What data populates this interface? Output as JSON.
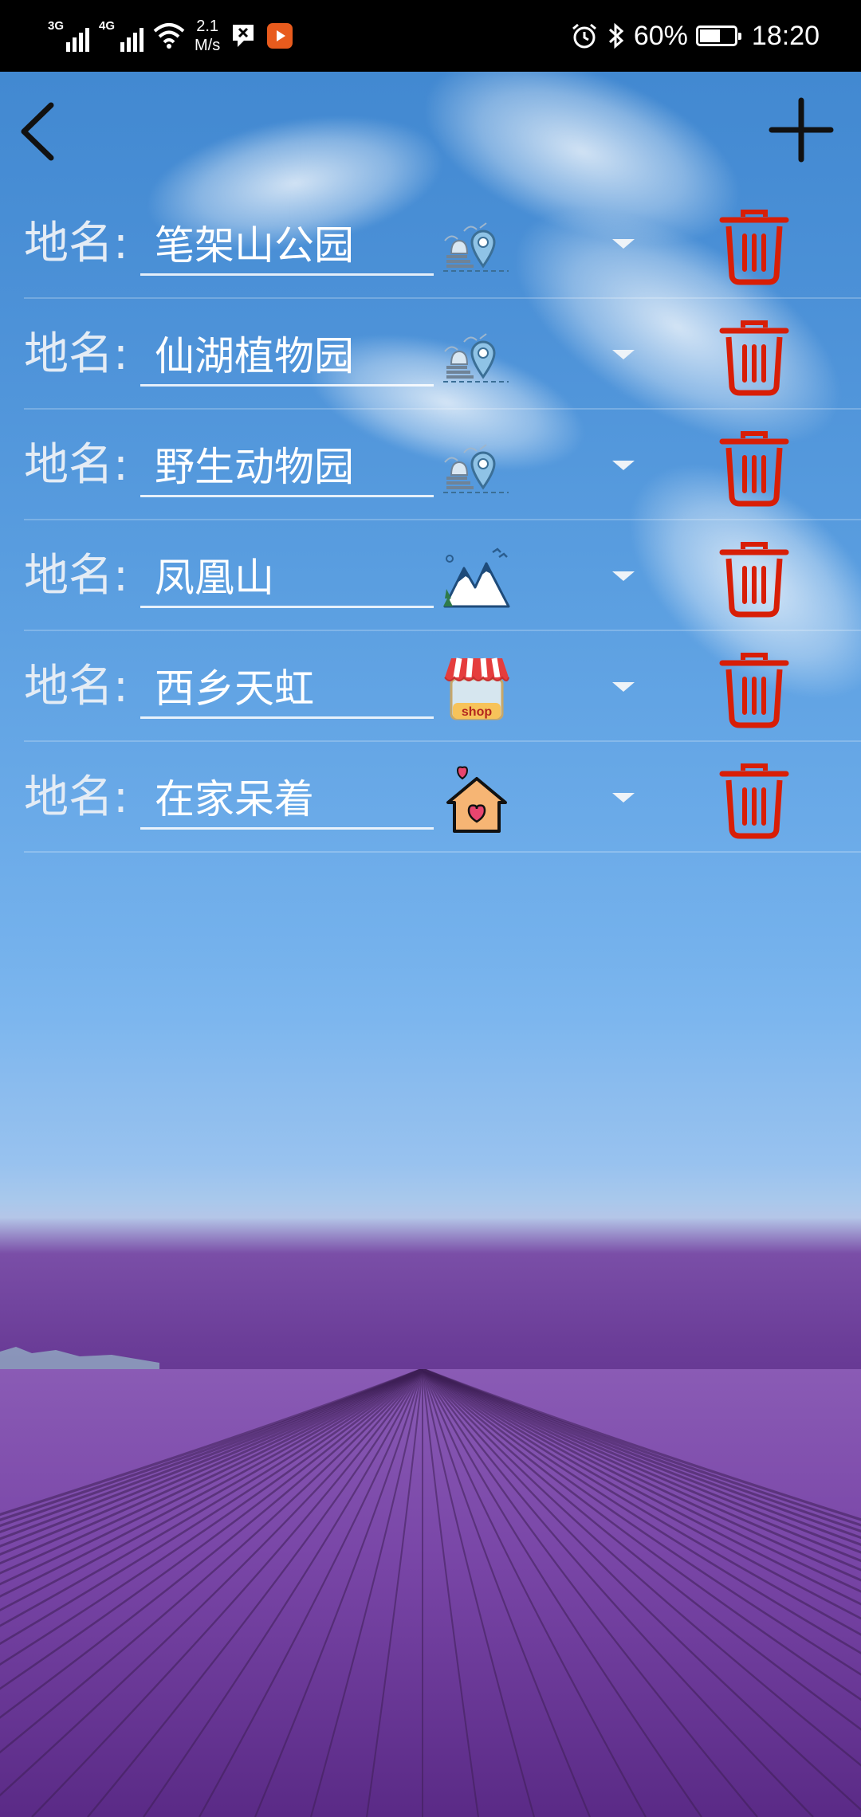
{
  "status_bar": {
    "signal1_tag": "3G",
    "signal2_tag": "4G",
    "speed_value": "2.1",
    "speed_unit": "M/s",
    "battery_percent": "60%",
    "battery_level": 0.6,
    "time": "18:20"
  },
  "toolbar": {
    "back_icon": "chevron-left-icon",
    "add_icon": "plus-icon"
  },
  "place_label": "地名:",
  "places": [
    {
      "name": "笔架山公园",
      "icon": "park-location-icon"
    },
    {
      "name": "仙湖植物园",
      "icon": "park-location-icon"
    },
    {
      "name": "野生动物园",
      "icon": "park-location-icon"
    },
    {
      "name": "凤凰山",
      "icon": "mountain-icon"
    },
    {
      "name": "西乡天虹",
      "icon": "shop-icon"
    },
    {
      "name": "在家呆着",
      "icon": "home-heart-icon"
    }
  ],
  "shop_sign": "shop",
  "colors": {
    "delete": "#d81e06",
    "status_bar_bg": "#000000",
    "text": "#ffffff"
  }
}
